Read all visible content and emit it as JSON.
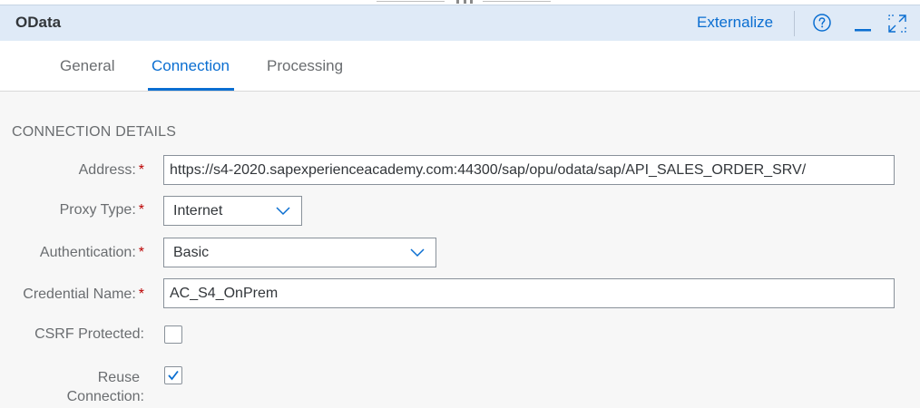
{
  "window": {
    "title": "OData",
    "externalize_label": "Externalize",
    "icons": [
      "help-icon",
      "minimize-icon",
      "maximize-icon"
    ]
  },
  "tabs": [
    {
      "label": "General",
      "active": false
    },
    {
      "label": "Connection",
      "active": true
    },
    {
      "label": "Processing",
      "active": false
    }
  ],
  "section": {
    "title": "CONNECTION DETAILS"
  },
  "fields": {
    "address": {
      "label": "Address:",
      "required": "*",
      "value": "https://s4-2020.sapexperienceacademy.com:44300/sap/opu/odata/sap/API_SALES_ORDER_SRV/"
    },
    "proxy_type": {
      "label": "Proxy Type:",
      "required": "*",
      "value": "Internet"
    },
    "authentication": {
      "label": "Authentication:",
      "required": "*",
      "value": "Basic"
    },
    "credential_name": {
      "label": "Credential Name:",
      "required": "*",
      "value": "AC_S4_OnPrem"
    },
    "csrf_protected": {
      "label": "CSRF Protected:",
      "checked": false
    },
    "reuse_connection": {
      "label_line1": "Reuse",
      "label_line2": "Connection:",
      "checked": true
    }
  },
  "colors": {
    "accent": "#0a6ed1",
    "header_bg": "#dfeaf7",
    "required": "#bb0000"
  }
}
